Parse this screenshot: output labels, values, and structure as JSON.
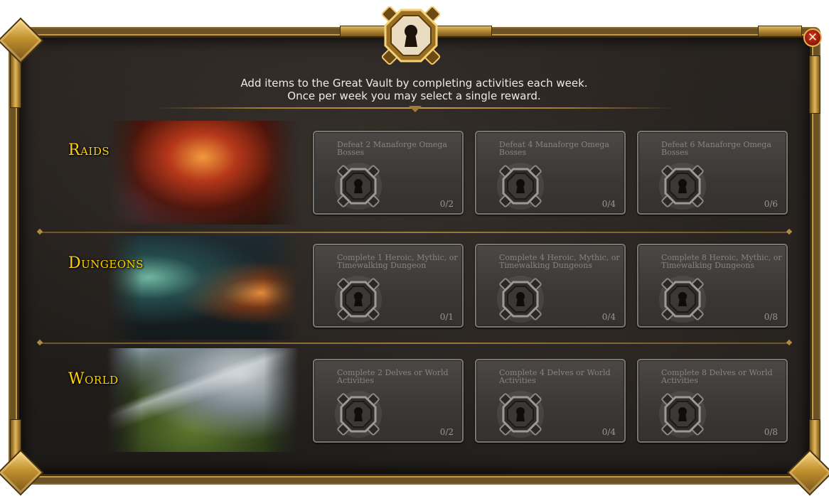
{
  "window": {
    "intro_line1": "Add items to the Great Vault by completing activities each week.",
    "intro_line2": "Once per week you may select a single reward.",
    "close_glyph": "✕",
    "accent_gold": "#ffd200",
    "lock_icon": "keyhole-lock-icon"
  },
  "categories": [
    {
      "title": "Raids",
      "art": "raid-boss-art",
      "slots": [
        {
          "desc": "Defeat 2 Manaforge Omega Bosses",
          "progress": "0/2"
        },
        {
          "desc": "Defeat 4 Manaforge Omega Bosses",
          "progress": "0/4"
        },
        {
          "desc": "Defeat 6 Manaforge Omega Bosses",
          "progress": "0/6"
        }
      ]
    },
    {
      "title": "Dungeons",
      "art": "dungeon-entrance-art",
      "slots": [
        {
          "desc": "Complete 1 Heroic, Mythic, or Timewalking Dungeon",
          "progress": "0/1"
        },
        {
          "desc": "Complete 4 Heroic, Mythic, or Timewalking Dungeons",
          "progress": "0/4"
        },
        {
          "desc": "Complete 8 Heroic, Mythic, or Timewalking Dungeons",
          "progress": "0/8"
        }
      ]
    },
    {
      "title": "World",
      "art": "mountain-landscape-art",
      "slots": [
        {
          "desc": "Complete 2 Delves or World Activities",
          "progress": "0/2"
        },
        {
          "desc": "Complete 4 Delves or World Activities",
          "progress": "0/4"
        },
        {
          "desc": "Complete 8 Delves or World Activities",
          "progress": "0/8"
        }
      ]
    }
  ]
}
